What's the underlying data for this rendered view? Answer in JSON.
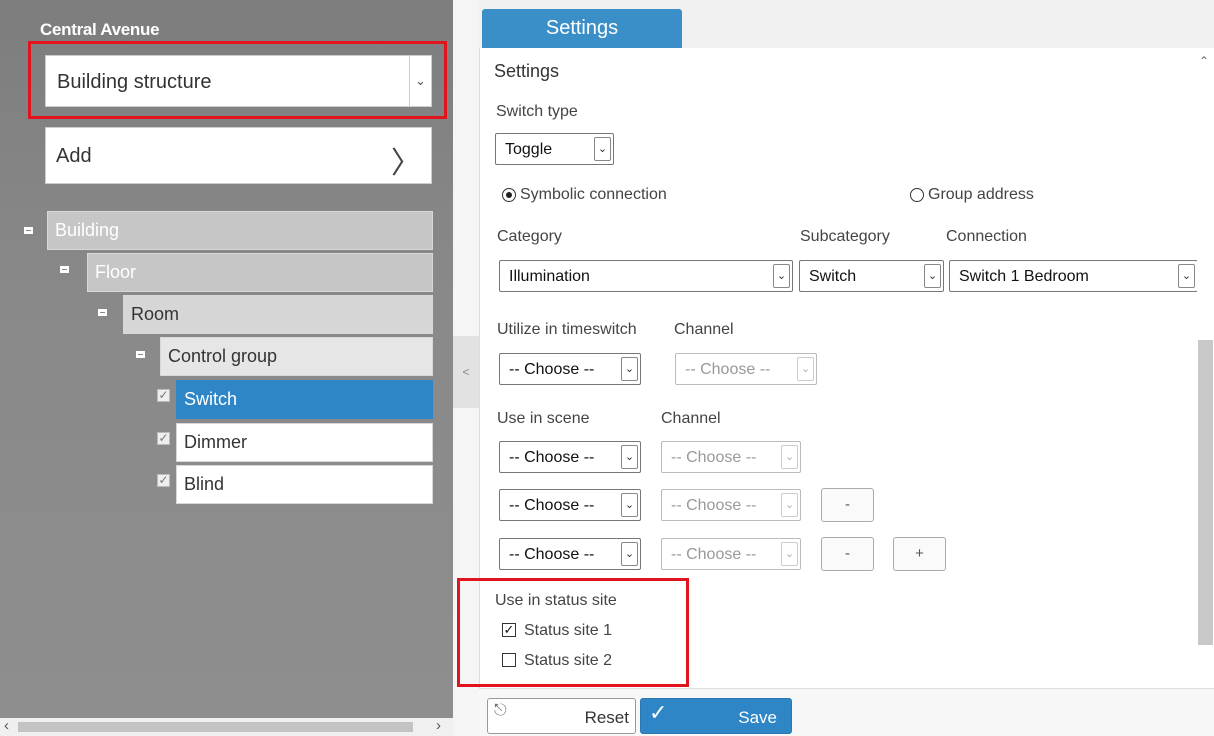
{
  "left": {
    "site_title": "Central Avenue",
    "view_select_value": "Building structure",
    "add_label": "Add",
    "tree": {
      "building": "Building",
      "floor": "Floor",
      "room": "Room",
      "control_group": "Control group",
      "items": [
        "Switch",
        "Dimmer",
        "Blind"
      ]
    }
  },
  "tabs": {
    "active": "Settings"
  },
  "settings": {
    "heading": "Settings",
    "switch_type_label": "Switch type",
    "switch_type_value": "Toggle",
    "radio_symbolic": "Symbolic connection",
    "radio_group": "Group address",
    "category_label": "Category",
    "subcategory_label": "Subcategory",
    "connection_label": "Connection",
    "category_value": "Illumination",
    "subcategory_value": "Switch",
    "connection_value": "Switch 1 Bedroom",
    "timeswitch_label": "Utilize in timeswitch",
    "channel_label": "Channel",
    "choose": "-- Choose --",
    "scene_label": "Use in scene",
    "minus": "-",
    "plus": "+",
    "status_label": "Use in status site",
    "status_site_1": "Status site 1",
    "status_site_2": "Status site 2"
  },
  "footer": {
    "reset": "Reset",
    "save": "Save"
  },
  "colors": {
    "accent": "#2f86c6",
    "highlight": "#e0141d"
  }
}
